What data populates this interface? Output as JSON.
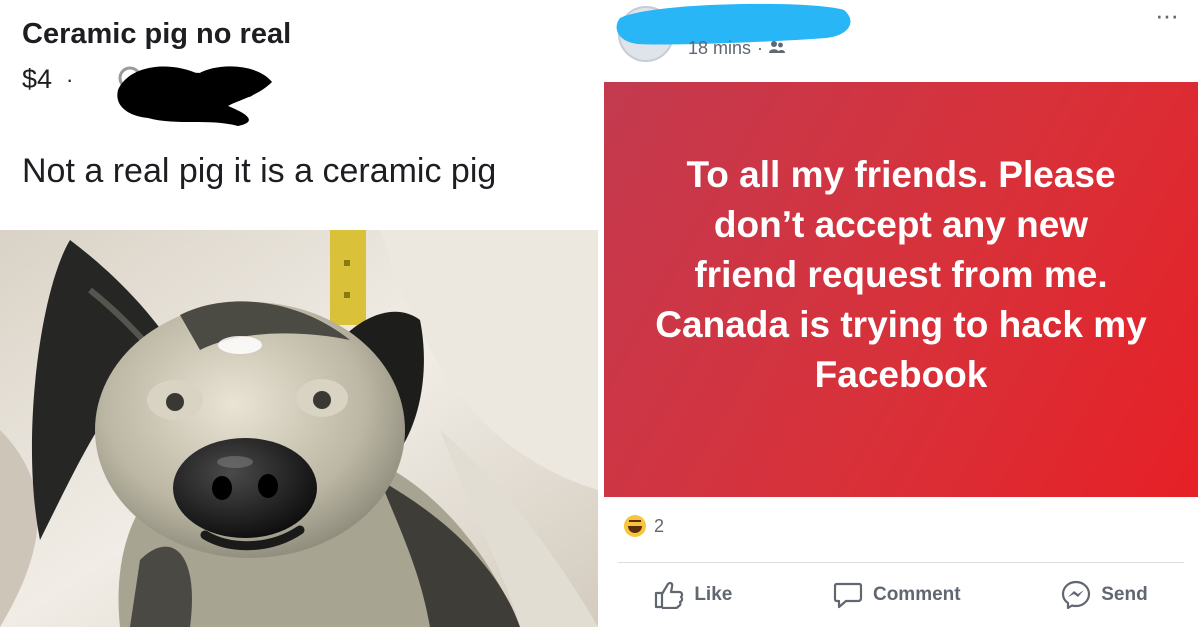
{
  "listing": {
    "title": "Ceramic pig no real",
    "price": "$4",
    "separator": "·",
    "description": "Not a real pig it is a ceramic pig"
  },
  "post": {
    "time": "18 mins",
    "separator": "·",
    "audience_icon": "friends-icon",
    "message": "To all my friends. Please\ndon’t  accept any new\nfriend request from me.\nCanada is trying to hack my\nFacebook",
    "banner_colors": [
      "#c33a4f",
      "#e62026"
    ],
    "reaction_icon": "haha-emoji-icon",
    "reaction_count": "2",
    "actions": {
      "like": "Like",
      "comment": "Comment",
      "send": "Send"
    }
  },
  "colors": {
    "redaction_blue": "#29b6f6",
    "redaction_black": "#000000",
    "meta_gray": "#606770"
  }
}
